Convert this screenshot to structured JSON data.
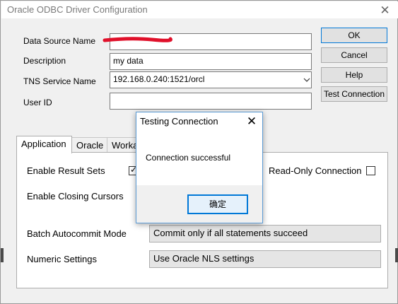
{
  "window": {
    "title": "Oracle ODBC Driver Configuration",
    "close_glyph": "✕"
  },
  "form": {
    "data_source_name": {
      "label": "Data Source Name",
      "value": ""
    },
    "description": {
      "label": "Description",
      "value": "my data"
    },
    "tns_service_name": {
      "label": "TNS Service Name",
      "value": "192.168.0.240:1521/orcl"
    },
    "user_id": {
      "label": "User ID",
      "value": ""
    }
  },
  "side_buttons": {
    "ok": "OK",
    "cancel": "Cancel",
    "help": "Help",
    "test_connection": "Test Connection"
  },
  "tabs": [
    {
      "label": "Application"
    },
    {
      "label": "Oracle"
    },
    {
      "label": "Workarounds"
    }
  ],
  "application": {
    "enable_result_sets": {
      "label": "Enable Result Sets",
      "checked": true
    },
    "read_only_connection": {
      "label": "Read-Only Connection",
      "checked": false
    },
    "enable_closing_cursors": {
      "label": "Enable Closing Cursors"
    },
    "batch_autocommit_mode": {
      "label": "Batch Autocommit Mode",
      "value": "Commit only if all statements succeed"
    },
    "numeric_settings": {
      "label": "Numeric Settings",
      "value": "Use Oracle NLS settings"
    }
  },
  "dialog": {
    "title": "Testing Connection",
    "message": "Connection successful",
    "ok_label": "确定",
    "close_glyph": "✕"
  },
  "colors": {
    "accent": "#0078d7",
    "redaction": "#e0102a"
  }
}
